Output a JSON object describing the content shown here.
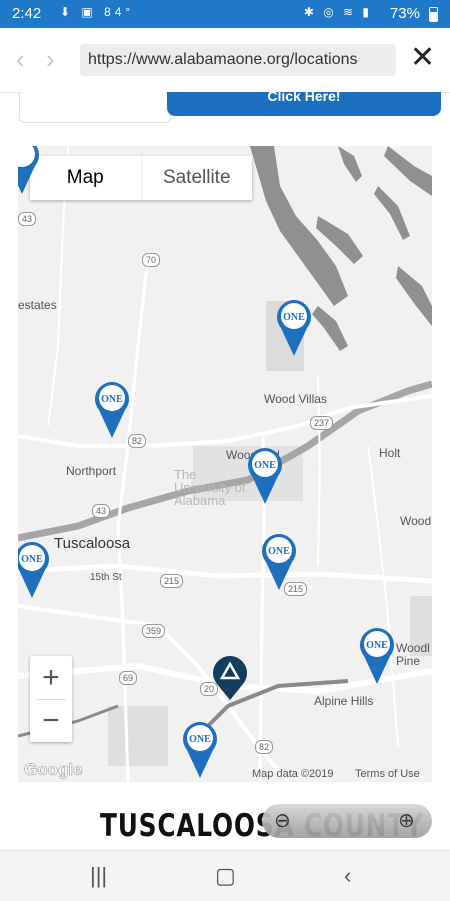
{
  "status_bar": {
    "time": "2:42",
    "temperature": "84°",
    "battery": "73%"
  },
  "browser": {
    "url": "https://www.alabamaone.org/locations",
    "back_icon": "back-icon",
    "forward_icon": "forward-icon",
    "close_icon": "close-icon"
  },
  "map": {
    "type_controls": {
      "map_label": "Map",
      "satellite_label": "Satellite"
    },
    "zoom": {
      "in_label": "+",
      "out_label": "−"
    },
    "labels": {
      "estates": "estates",
      "wood_villas": "Wood Villas",
      "holt": "Holt",
      "northport": "Northport",
      "woodland": "Woodland",
      "university": "The University of Alabama",
      "tuscaloosa": "Tuscaloosa",
      "wood_right": "Wood",
      "fifteenth": "15th St",
      "alpine_hills": "Alpine Hills",
      "woodl_pine": "Woodl Pine"
    },
    "shields": {
      "r43": "43",
      "r70": "70",
      "r82a": "82",
      "r237": "237",
      "r43b": "43",
      "r215a": "215",
      "r215b": "215",
      "r359": "359",
      "r69": "69",
      "r20": "20",
      "r82b": "82"
    },
    "marker_text": "ONE",
    "google": "Google",
    "map_data": "Map data ©2019",
    "terms": "Terms of Use"
  },
  "page": {
    "county_title": "TUSCALOOSA COUNTY",
    "button_text": "Click Here!"
  }
}
